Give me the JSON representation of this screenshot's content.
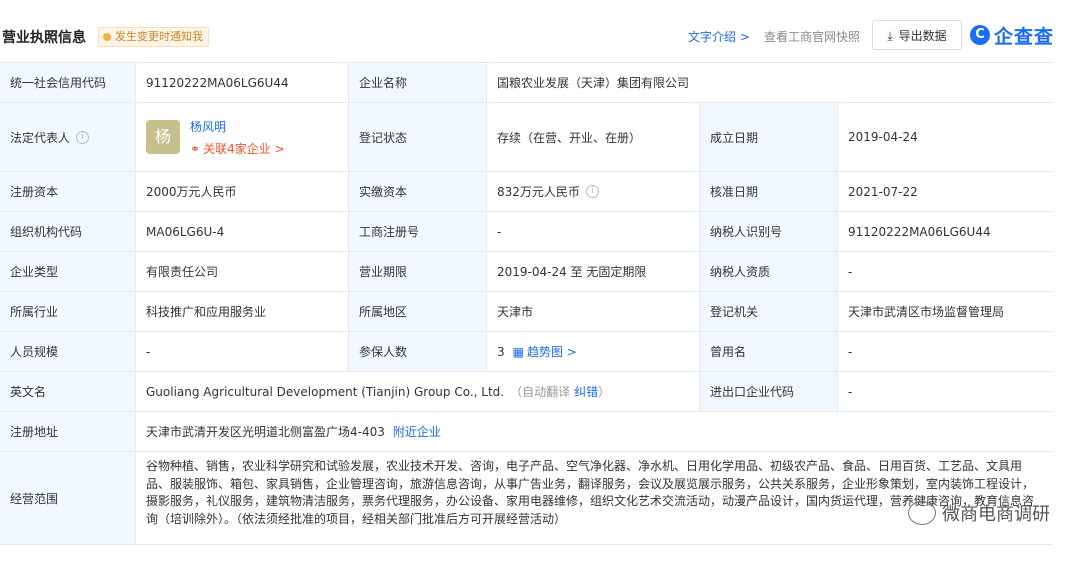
{
  "header": {
    "title": "营业执照信息",
    "badge": "发生变更时通知我",
    "text_intro": "文字介绍 >",
    "snapshot": "查看工商官网快照",
    "export": "导出数据",
    "logo": "企查查"
  },
  "rows": {
    "credit_code_label": "统一社会信用代码",
    "credit_code": "91120222MA06LG6U44",
    "company_name_label": "企业名称",
    "company_name": "国粮农业发展（天津）集团有限公司",
    "legal_rep_label": "法定代表人",
    "legal_rep_avatar": "杨",
    "legal_rep_name": "杨风明",
    "legal_rep_related": "关联4家企业 >",
    "reg_status_label": "登记状态",
    "reg_status": "存续（在营、开业、在册）",
    "founded_label": "成立日期",
    "founded": "2019-04-24",
    "reg_capital_label": "注册资本",
    "reg_capital": "2000万元人民币",
    "paid_capital_label": "实缴资本",
    "paid_capital": "832万元人民币",
    "approval_date_label": "核准日期",
    "approval_date": "2021-07-22",
    "org_code_label": "组织机构代码",
    "org_code": "MA06LG6U-4",
    "biz_reg_no_label": "工商注册号",
    "biz_reg_no": "-",
    "taxpayer_id_label": "纳税人识别号",
    "taxpayer_id": "91120222MA06LG6U44",
    "company_type_label": "企业类型",
    "company_type": "有限责任公司",
    "biz_term_label": "营业期限",
    "biz_term": "2019-04-24 至 无固定期限",
    "taxpayer_qual_label": "纳税人资质",
    "taxpayer_qual": "-",
    "industry_label": "所属行业",
    "industry": "科技推广和应用服务业",
    "region_label": "所属地区",
    "region": "天津市",
    "reg_authority_label": "登记机关",
    "reg_authority": "天津市武清区市场监督管理局",
    "staff_size_label": "人员规模",
    "staff_size": "-",
    "insured_label": "参保人数",
    "insured": "3",
    "trend_link": "趋势图 >",
    "former_name_label": "曾用名",
    "former_name": "-",
    "english_name_label": "英文名",
    "english_name": "Guoliang Agricultural Development (Tianjin) Group Co., Ltd.",
    "auto_translate": "（自动翻译",
    "correct_link": "纠错",
    "auto_translate_end": "）",
    "import_export_label": "进出口企业代码",
    "import_export": "-",
    "address_label": "注册地址",
    "address": "天津市武清开发区光明道北侧富盈广场4-403",
    "nearby_link": "附近企业",
    "scope_label": "经营范围",
    "scope": "谷物种植、销售，农业科学研究和试验发展，农业技术开发、咨询，电子产品、空气净化器、净水机、日用化学用品、初级农产品、食品、日用百货、工艺品、文具用品、服装服饰、箱包、家具销售，企业管理咨询，旅游信息咨询，从事广告业务，翻译服务，会议及展览展示服务，公共关系服务，企业形象策划，室内装饰工程设计，摄影服务，礼仪服务，建筑物清洁服务，票务代理服务，办公设备、家用电器维修，组织文化艺术交流活动，动漫产品设计，国内货运代理，营养健康咨询，教育信息咨询（培训除外）。（依法须经批准的项目，经相关部门批准后方可开展经营活动）"
  },
  "watermark": "微商电商调研",
  "colors": {
    "accent": "#1a6cf2",
    "label_bg": "#f2f8ff",
    "orange": "#f0552e"
  }
}
